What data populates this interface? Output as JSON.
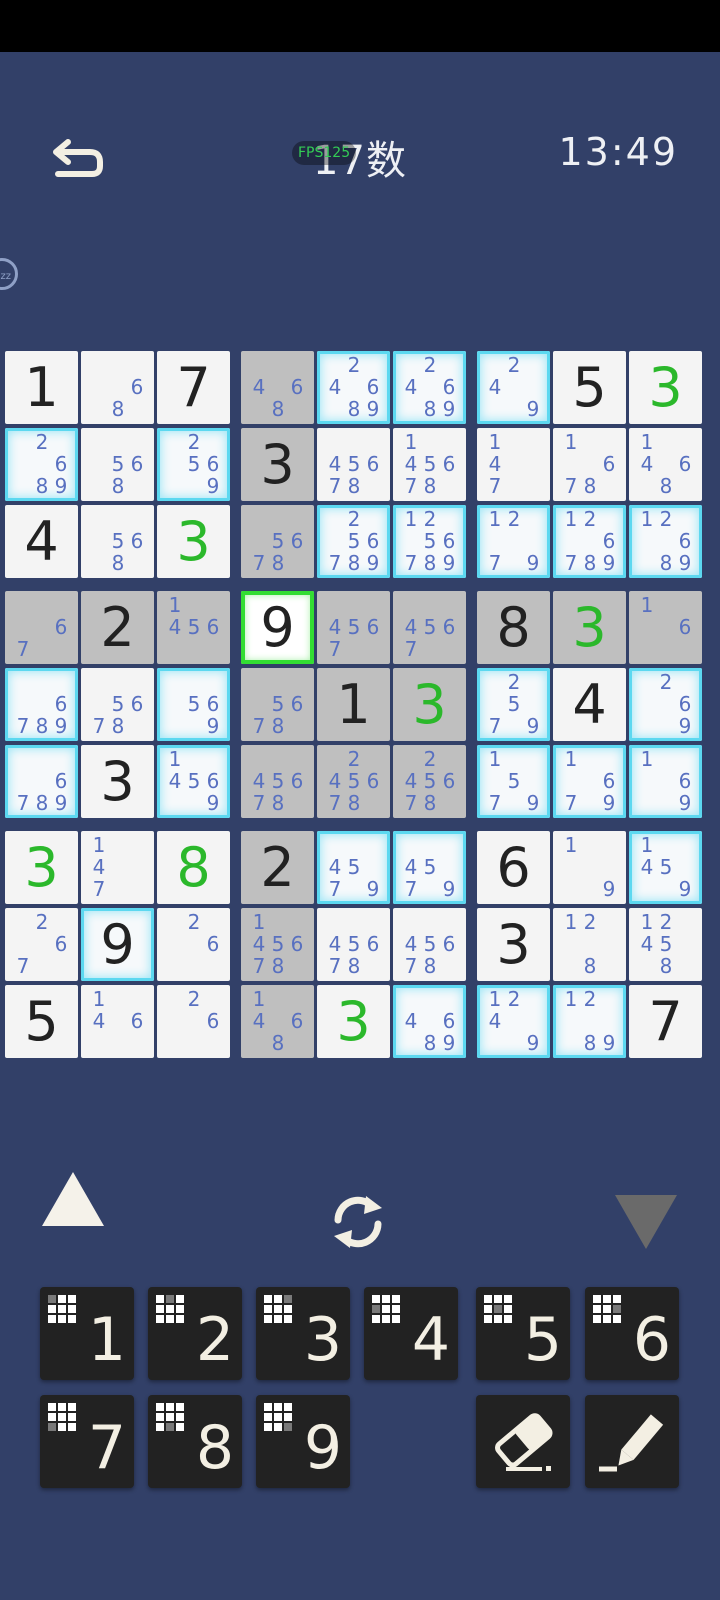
{
  "header": {
    "title": "17数",
    "fps": "FPS125",
    "timer": "13:49"
  },
  "icons": {
    "back": "back-arrow-icon",
    "sleep": "sleep-zz-icon",
    "refresh": "refresh-icon",
    "up": "triangle-up-icon",
    "down": "triangle-down-icon",
    "eraser": "eraser-icon",
    "pencil": "pencil-icon"
  },
  "colors": {
    "background": "#324068",
    "given_digit": "#222222",
    "placed_digit_green": "#2bb82b",
    "note_digit": "#5870c0",
    "highlight_glow": "#5cd8f0",
    "selection": "#33dd33"
  },
  "board": {
    "selected": [
      3,
      3
    ],
    "rows": [
      [
        {
          "v": "1"
        },
        {
          "n": "68"
        },
        {
          "v": "7"
        },
        {
          "n": "468",
          "g": 1
        },
        {
          "n": "24689",
          "h": 1
        },
        {
          "n": "24689",
          "h": 1
        },
        {
          "n": "249",
          "h": 1
        },
        {
          "v": "5"
        },
        {
          "v": "3",
          "c": "green"
        }
      ],
      [
        {
          "n": "2689",
          "h": 1
        },
        {
          "n": "568"
        },
        {
          "n": "2569",
          "h": 1
        },
        {
          "v": "3",
          "g": 1
        },
        {
          "n": "45678"
        },
        {
          "n": "145678"
        },
        {
          "n": "147"
        },
        {
          "n": "1678"
        },
        {
          "n": "1468"
        }
      ],
      [
        {
          "v": "4"
        },
        {
          "n": "568"
        },
        {
          "v": "3",
          "c": "green"
        },
        {
          "n": "5678",
          "g": 1
        },
        {
          "n": "256789",
          "h": 1
        },
        {
          "n": "1256789",
          "h": 1
        },
        {
          "n": "1279",
          "h": 1
        },
        {
          "n": "126789",
          "h": 1
        },
        {
          "n": "12689",
          "h": 1
        }
      ],
      [
        {
          "n": "67",
          "g": 1
        },
        {
          "v": "2",
          "g": 1
        },
        {
          "n": "1456",
          "g": 1
        },
        {
          "v": "9",
          "s": 1
        },
        {
          "n": "4567",
          "g": 1
        },
        {
          "n": "4567",
          "g": 1
        },
        {
          "v": "8",
          "g": 1
        },
        {
          "v": "3",
          "c": "green",
          "g": 1
        },
        {
          "n": "16",
          "g": 1
        }
      ],
      [
        {
          "n": "6789",
          "h": 1
        },
        {
          "n": "5678"
        },
        {
          "n": "569",
          "h": 1
        },
        {
          "n": "5678",
          "g": 1
        },
        {
          "v": "1",
          "g": 1
        },
        {
          "v": "3",
          "c": "green",
          "g": 1
        },
        {
          "n": "2579",
          "h": 1
        },
        {
          "v": "4"
        },
        {
          "n": "269",
          "h": 1
        }
      ],
      [
        {
          "n": "6789",
          "h": 1
        },
        {
          "v": "3"
        },
        {
          "n": "14569",
          "h": 1
        },
        {
          "n": "45678",
          "g": 1
        },
        {
          "n": "245678",
          "g": 1
        },
        {
          "n": "245678",
          "g": 1
        },
        {
          "n": "1579",
          "h": 1
        },
        {
          "n": "1679",
          "h": 1
        },
        {
          "n": "169",
          "h": 1
        }
      ],
      [
        {
          "v": "3",
          "c": "green"
        },
        {
          "n": "147"
        },
        {
          "v": "8",
          "c": "green"
        },
        {
          "v": "2",
          "g": 1
        },
        {
          "n": "4579",
          "h": 1
        },
        {
          "n": "4579",
          "h": 1
        },
        {
          "v": "6"
        },
        {
          "n": "19"
        },
        {
          "n": "1459",
          "h": 1
        }
      ],
      [
        {
          "n": "267"
        },
        {
          "v": "9",
          "h": 1
        },
        {
          "n": "26"
        },
        {
          "n": "145678",
          "g": 1
        },
        {
          "n": "45678"
        },
        {
          "n": "45678"
        },
        {
          "v": "3"
        },
        {
          "n": "128"
        },
        {
          "n": "12458"
        }
      ],
      [
        {
          "v": "5"
        },
        {
          "n": "146"
        },
        {
          "n": "26"
        },
        {
          "n": "1468",
          "g": 1
        },
        {
          "v": "3",
          "c": "green"
        },
        {
          "n": "4689",
          "h": 1
        },
        {
          "n": "1249",
          "h": 1
        },
        {
          "n": "1289",
          "h": 1
        },
        {
          "v": "7"
        }
      ]
    ]
  },
  "keypad": {
    "numbers": [
      "1",
      "2",
      "3",
      "4",
      "5",
      "6",
      "7",
      "8",
      "9"
    ]
  }
}
